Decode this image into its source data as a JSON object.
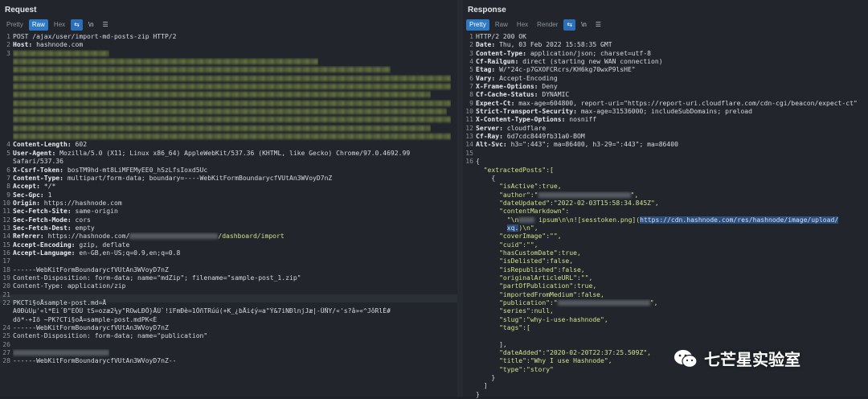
{
  "request": {
    "title": "Request",
    "toolbar": {
      "pretty": "Pretty",
      "raw": "Raw",
      "hex": "Hex",
      "wrap_icon": "wrap-icon",
      "newline": "\\n",
      "menu_icon": "menu-icon"
    },
    "lines": [
      {
        "n": "1",
        "k": "",
        "v": "POST /ajax/user/import-md-posts-zip HTTP/2"
      },
      {
        "n": "2",
        "k": "Host:",
        "v": " hashnode.com"
      },
      {
        "n": "3",
        "k": "",
        "v": "",
        "blur": 120
      },
      {
        "n": "",
        "k": "",
        "v": "",
        "blur": 380
      },
      {
        "n": "",
        "k": "",
        "v": "",
        "blur": 470
      },
      {
        "n": "",
        "k": "",
        "v": "",
        "blur": 545
      },
      {
        "n": "",
        "k": "",
        "v": "",
        "blur": 545
      },
      {
        "n": "",
        "k": "",
        "v": "",
        "blur": 520
      },
      {
        "n": "",
        "k": "",
        "v": "",
        "blur": 545
      },
      {
        "n": "",
        "k": "",
        "v": "",
        "blur": 540
      },
      {
        "n": "",
        "k": "",
        "v": "",
        "blur": 545
      },
      {
        "n": "",
        "k": "",
        "v": "",
        "blur": 520
      },
      {
        "n": "",
        "k": "",
        "v": "",
        "blur": 545
      },
      {
        "n": "4",
        "k": "Content-Length:",
        "v": " 602"
      },
      {
        "n": "5",
        "k": "User-Agent:",
        "v": " Mozilla/5.0 (X11; Linux x86_64) AppleWebKit/537.36 (KHTML, like Gecko) Chrome/97.0.4692.99"
      },
      {
        "n": "",
        "k": "",
        "v": "Safari/537.36"
      },
      {
        "n": "6",
        "k": "X-Csrf-Token:",
        "v": " bosTM9hd-mt8LiMFEMyEE0_hSzLfsIoxd5Uc"
      },
      {
        "n": "7",
        "k": "Content-Type:",
        "v": " multipart/form-data; boundary=----WebKitFormBoundarycfVUtAn3WVoyD7nZ"
      },
      {
        "n": "8",
        "k": "Accept:",
        "v": " */*"
      },
      {
        "n": "9",
        "k": "Sec-Gpc:",
        "v": " 1"
      },
      {
        "n": "10",
        "k": "Origin:",
        "v": " https://hashnode.com"
      },
      {
        "n": "11",
        "k": "Sec-Fetch-Site:",
        "v": " same-origin"
      },
      {
        "n": "12",
        "k": "Sec-Fetch-Mode:",
        "v": " cors"
      },
      {
        "n": "13",
        "k": "Sec-Fetch-Dest:",
        "v": " empty"
      },
      {
        "n": "14",
        "k": "Referer:",
        "v": " https://hashnode.com/",
        "blurg": 110,
        "v2": "/dashboard/import"
      },
      {
        "n": "15",
        "k": "Accept-Encoding:",
        "v": " gzip, deflate"
      },
      {
        "n": "16",
        "k": "Accept-Language:",
        "v": " en-GB,en-US;q=0.9,en;q=0.8"
      },
      {
        "n": "17",
        "k": "",
        "v": ""
      },
      {
        "n": "18",
        "k": "",
        "v": "------WebKitFormBoundarycfVUtAn3WVoyD7nZ"
      },
      {
        "n": "19",
        "k": "",
        "v": "Content-Disposition: form-data; name=\"mdZip\"; filename=\"sample-post_1.zip\""
      },
      {
        "n": "20",
        "k": "",
        "v": "Content-Type: application/zip"
      },
      {
        "n": "21",
        "k": "",
        "v": ""
      },
      {
        "n": "22",
        "k": "",
        "v": "PK\u0003\u0004\u0014CTi\u0010\u0005§oÅsample-post.md=\u0011Å"
      },
      {
        "n": "",
        "k": "",
        "v": "A0ÐùU\u0002µ'«l*Ei´Ð\u001c\u0016\"EÔÙ tS=ozæ2¼y\"\u001dROwLÐÕ\u001c}ÅÙ`!ï\u0018FmÐè=1ÕñT\u0016R\u0011úú(+K\u0013_¿bÅi¢ý=a\"Ý&7\u0019iNÐln\u0010j\u001eJæ|-ÛÑY/\u001e«'s?â»«^JôRlÉ#"
      },
      {
        "n": "",
        "k": "",
        "v": "\u0010\u0016dö*-+Iö ~PK?\u0010\u0005CTi\u0010§o\u0010Å=\u0010sample-post.mdPK<É"
      },
      {
        "n": "24",
        "k": "",
        "v": "------WebKitFormBoundarycfVUtAn3WVoyD7nZ"
      },
      {
        "n": "25",
        "k": "",
        "v": "Content-Disposition: form-data; name=\"publication\""
      },
      {
        "n": "26",
        "k": "",
        "v": ""
      },
      {
        "n": "27",
        "k": "",
        "v": "",
        "blurg": 120
      },
      {
        "n": "28",
        "k": "",
        "v": "------WebKitFormBoundarycfVUtAn3WVoyD7nZ--"
      }
    ]
  },
  "response": {
    "title": "Response",
    "toolbar": {
      "pretty": "Pretty",
      "raw": "Raw",
      "hex": "Hex",
      "render": "Render",
      "wrap_icon": "wrap-icon",
      "newline": "\\n",
      "menu_icon": "menu-icon"
    },
    "lines": [
      {
        "n": "1",
        "k": "",
        "v": "HTTP/2 200 OK"
      },
      {
        "n": "2",
        "k": "Date:",
        "v": " Thu, 03 Feb 2022 15:58:35 GMT"
      },
      {
        "n": "3",
        "k": "Content-Type:",
        "v": " application/json; charset=utf-8"
      },
      {
        "n": "4",
        "k": "Cf-Railgun:",
        "v": " direct (starting new WAN connection)"
      },
      {
        "n": "5",
        "k": "Etag:",
        "v": " W/\"24c-p7GXOFCRcrs/KH6kg70wxP9lsHE\""
      },
      {
        "n": "6",
        "k": "Vary:",
        "v": " Accept-Encoding"
      },
      {
        "n": "7",
        "k": "X-Frame-Options:",
        "v": " Deny"
      },
      {
        "n": "8",
        "k": "Cf-Cache-Status:",
        "v": " DYNAMIC"
      },
      {
        "n": "9",
        "k": "Expect-Ct:",
        "v": " max-age=604800, report-uri=\"https://report-uri.cloudflare.com/cdn-cgi/beacon/expect-ct\""
      },
      {
        "n": "10",
        "k": "Strict-Transport-Security:",
        "v": " max-age=31536000; includeSubDomains; preload"
      },
      {
        "n": "11",
        "k": "X-Content-Type-Options:",
        "v": " nosniff"
      },
      {
        "n": "12",
        "k": "Server:",
        "v": " cloudflare"
      },
      {
        "n": "13",
        "k": "Cf-Ray:",
        "v": " 6d7cdc8449fb31a0-BOM"
      },
      {
        "n": "14",
        "k": "Alt-Svc:",
        "v": " h3=\":443\"; ma=86400, h3-29=\":443\"; ma=86400"
      },
      {
        "n": "15",
        "k": "",
        "v": ""
      },
      {
        "n": "16",
        "k": "",
        "v": "{"
      },
      {
        "n": "",
        "k": "",
        "v": "  \"extractedPosts\":[",
        "s": 1
      },
      {
        "n": "",
        "k": "",
        "v": "    {"
      },
      {
        "n": "",
        "k": "",
        "v": "      \"isActive\":true,",
        "s": 1
      },
      {
        "n": "",
        "k": "",
        "v": "      \"author\":\"",
        "s": 1,
        "blurg": 115,
        "v2": "\","
      },
      {
        "n": "",
        "k": "",
        "v": "      \"dateUpdated\":\"2022-02-03T15:58:34.845Z\",",
        "s": 1
      },
      {
        "n": "",
        "k": "",
        "v": "      \"contentMarkdown\":",
        "s": 1
      },
      {
        "n": "",
        "k": "",
        "v": "        \"\\n",
        "s": 1,
        "blurg": 20,
        "v2": " ipsum\\n\\n![sesstoken.png](",
        "sel": "https://cdn.hashnode.com/res/hashnode/image/upload/"
      },
      {
        "n": "",
        "k": "",
        "v": "        ",
        "sel2": "xq.",
        "v3": ")\\n\","
      },
      {
        "n": "",
        "k": "",
        "v": "      \"coverImage\":\"\",",
        "s": 1
      },
      {
        "n": "",
        "k": "",
        "v": "      \"cuid\":\"\",",
        "s": 1
      },
      {
        "n": "",
        "k": "",
        "v": "      \"hasCustomDate\":true,",
        "s": 1
      },
      {
        "n": "",
        "k": "",
        "v": "      \"isDelisted\":false,",
        "s": 1
      },
      {
        "n": "",
        "k": "",
        "v": "      \"isRepublished\":false,",
        "s": 1
      },
      {
        "n": "",
        "k": "",
        "v": "      \"originalArticleURL\":\"\",",
        "s": 1
      },
      {
        "n": "",
        "k": "",
        "v": "      \"partOfPublication\":true,",
        "s": 1
      },
      {
        "n": "",
        "k": "",
        "v": "      \"importedFromMedium\":false,",
        "s": 1
      },
      {
        "n": "",
        "k": "",
        "v": "      \"publication\":\"",
        "s": 1,
        "blurg": 115,
        "v2": "\","
      },
      {
        "n": "",
        "k": "",
        "v": "      \"series\":null,",
        "s": 1
      },
      {
        "n": "",
        "k": "",
        "v": "      \"slug\":\"why-i-use-hashnode\",",
        "s": 1
      },
      {
        "n": "",
        "k": "",
        "v": "      \"tags\":[",
        "s": 1
      },
      {
        "n": "",
        "k": "",
        "v": ""
      },
      {
        "n": "",
        "k": "",
        "v": "      ],"
      },
      {
        "n": "",
        "k": "",
        "v": "      \"dateAdded\":\"2020-02-20T22:37:25.509Z\",",
        "s": 1
      },
      {
        "n": "",
        "k": "",
        "v": "      \"title\":\"Why I use Hashnode\",",
        "s": 1
      },
      {
        "n": "",
        "k": "",
        "v": "      \"type\":\"story\"",
        "s": 1
      },
      {
        "n": "",
        "k": "",
        "v": "    }"
      },
      {
        "n": "",
        "k": "",
        "v": "  ]"
      },
      {
        "n": "",
        "k": "",
        "v": "}"
      }
    ]
  },
  "watermark": {
    "text": "七芒星实验室",
    "icon": "wechat-icon"
  },
  "colors": {
    "accent": "#2f78c4",
    "json_string": "#cfe28c",
    "bg": "#22262c"
  }
}
